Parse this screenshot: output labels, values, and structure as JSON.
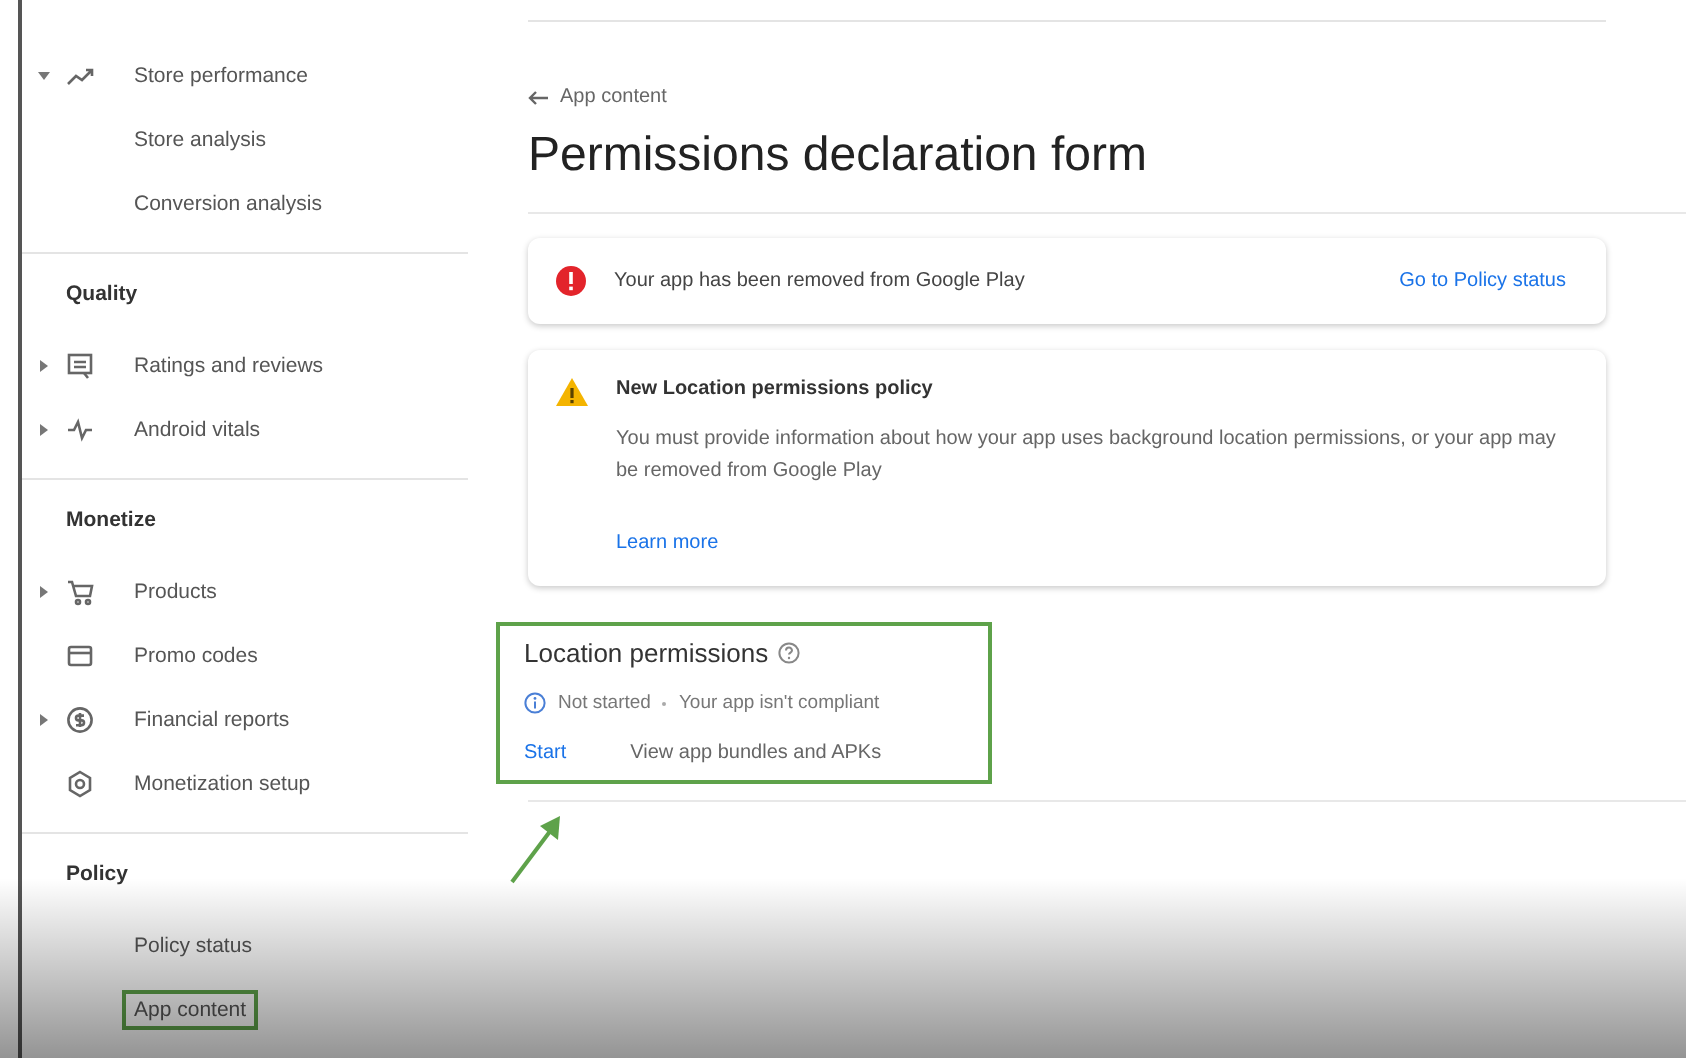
{
  "sidebar": {
    "sections": [
      {
        "items": [
          {
            "label": "Store performance",
            "kind": "expanded",
            "highlighted": false
          },
          {
            "label": "Store analysis",
            "kind": "sub",
            "highlighted": false
          },
          {
            "label": "Conversion analysis",
            "kind": "sub",
            "highlighted": false
          }
        ]
      },
      {
        "heading": "Quality",
        "items": [
          {
            "label": "Ratings and reviews",
            "kind": "collapsed",
            "highlighted": false
          },
          {
            "label": "Android vitals",
            "kind": "collapsed",
            "highlighted": false
          }
        ]
      },
      {
        "heading": "Monetize",
        "items": [
          {
            "label": "Products",
            "kind": "collapsed",
            "highlighted": false
          },
          {
            "label": "Promo codes",
            "kind": "plain",
            "highlighted": false
          },
          {
            "label": "Financial reports",
            "kind": "collapsed",
            "highlighted": false
          },
          {
            "label": "Monetization setup",
            "kind": "plain",
            "highlighted": false
          }
        ]
      },
      {
        "heading": "Policy",
        "items": [
          {
            "label": "Policy status",
            "kind": "sub",
            "highlighted": false
          },
          {
            "label": "App content",
            "kind": "sub",
            "highlighted": true
          }
        ]
      }
    ]
  },
  "breadcrumb": "App content",
  "title": "Permissions declaration form",
  "alerts": [
    {
      "kind": "error",
      "text": "Your app has been removed from Google Play",
      "action": "Go to Policy status"
    },
    {
      "kind": "warning",
      "title": "New Location permissions policy",
      "text": "You must provide information about how your app uses background location permissions, or your app may be removed from Google Play",
      "link": "Learn more"
    }
  ],
  "section": {
    "title": "Location permissions",
    "highlighted": true,
    "status": "Not started",
    "status_detail": "Your app isn't compliant",
    "actions": [
      {
        "label": "Start",
        "kind": "link"
      },
      {
        "label": "View app bundles and APKs",
        "kind": "text"
      }
    ]
  }
}
